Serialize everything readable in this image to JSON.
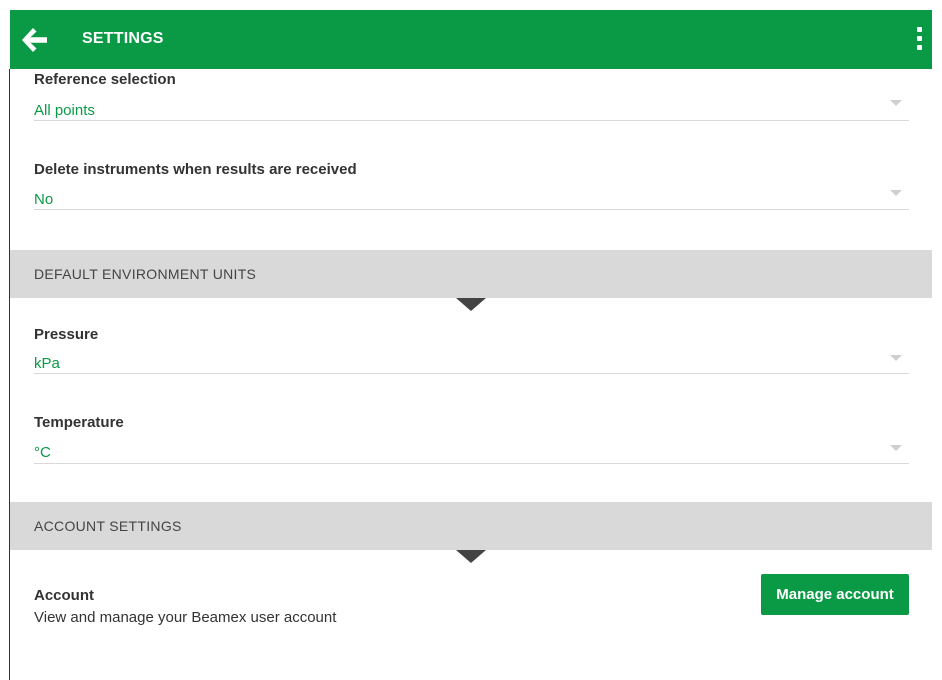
{
  "header": {
    "title": "SETTINGS",
    "back_icon": "arrow-left-icon",
    "menu_icon": "more-vertical-icon",
    "color": "#0a9a46"
  },
  "fields": {
    "reference_selection": {
      "label": "Reference selection",
      "value": "All points"
    },
    "delete_instruments": {
      "label": "Delete instruments when results are received",
      "value": "No"
    },
    "pressure": {
      "label": "Pressure",
      "value": "kPa"
    },
    "temperature": {
      "label": "Temperature",
      "value": "°C"
    }
  },
  "sections": {
    "environment_units": {
      "title": "DEFAULT ENVIRONMENT UNITS"
    },
    "account_settings": {
      "title": "ACCOUNT SETTINGS"
    }
  },
  "account": {
    "label": "Account",
    "description": "View and manage your Beamex user account",
    "button_label": "Manage account"
  },
  "colors": {
    "accent": "#0a9a46",
    "section_bg": "#d9d9d9"
  }
}
